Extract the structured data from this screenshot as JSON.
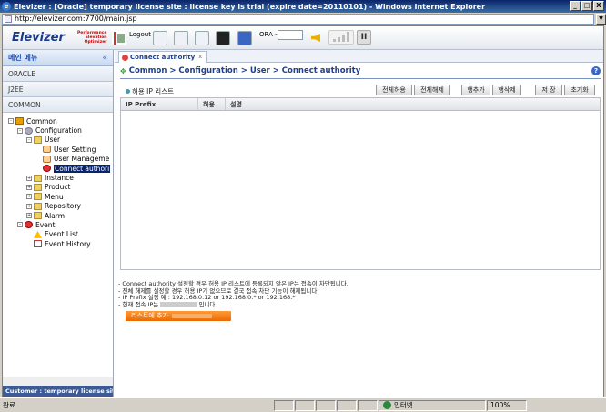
{
  "window": {
    "title": "Elevizer : [Oracle] temporary license site : license key is trial (expire date=20110101) - Windows Internet Explorer",
    "minimize": "_",
    "maximize": "□",
    "close": "X"
  },
  "address": {
    "url": "http://elevizer.com:7700/main.jsp",
    "dropdown": "▼"
  },
  "toolbar": {
    "logo": "Elevizer",
    "logo_tagline": [
      "Performance",
      "Elevation",
      "Optimizer"
    ],
    "logout_label": "Logout",
    "ora_label": "ORA -",
    "pause_label": "II"
  },
  "sidebar": {
    "header": "메인 메뉴",
    "collapse": "«",
    "categories": [
      "ORACLE",
      "J2EE",
      "COMMON"
    ],
    "tree": [
      {
        "label": "Common",
        "pm": "-"
      },
      {
        "label": "Configuration",
        "pm": "-"
      },
      {
        "label": "User",
        "pm": "-"
      },
      {
        "label": "User Setting"
      },
      {
        "label": "User Manageme"
      },
      {
        "label": "Connect authori"
      },
      {
        "label": "Instance",
        "pm": "+"
      },
      {
        "label": "Product",
        "pm": "+"
      },
      {
        "label": "Menu",
        "pm": "+"
      },
      {
        "label": "Repository",
        "pm": "+"
      },
      {
        "label": "Alarm",
        "pm": "+"
      },
      {
        "label": "Event",
        "pm": "-"
      },
      {
        "label": "Event List"
      },
      {
        "label": "Event History"
      }
    ],
    "footer": "Customer : temporary license site"
  },
  "main": {
    "tab_label": "Connect authority",
    "tab_close": "x",
    "breadcrumb": "Common > Configuration > User > Connect authority",
    "breadcrumb_icon": "✥",
    "help": "?",
    "panel_title": "허용 IP 리스트",
    "buttons": {
      "allow_all": "전체허용",
      "release_all": "전체해제",
      "add_row": "행추가",
      "delete_row": "행삭제",
      "save": "저 장",
      "reset": "초기화"
    },
    "columns": [
      "IP Prefix",
      "허용",
      "설명"
    ],
    "notes": [
      "- Connect authority 설정할 경우 허용 IP 리스트에 등록되지 않은 IP는 접속이 차단됩니다.",
      "- 전체 해제를 설정할 경우 허용 IP가 없으므로 결국 접속 차단 기능이 해제됩니다.",
      "- IP Prefix 설정 예 : 192.168.0.12 or 192.168.0.* or 192.168.*",
      "- 현재 접속 IP는",
      "입니다."
    ],
    "add_button": "리스트에 추가"
  },
  "status": {
    "text": "완료",
    "zone": "인터넷",
    "zoom": "100%"
  }
}
